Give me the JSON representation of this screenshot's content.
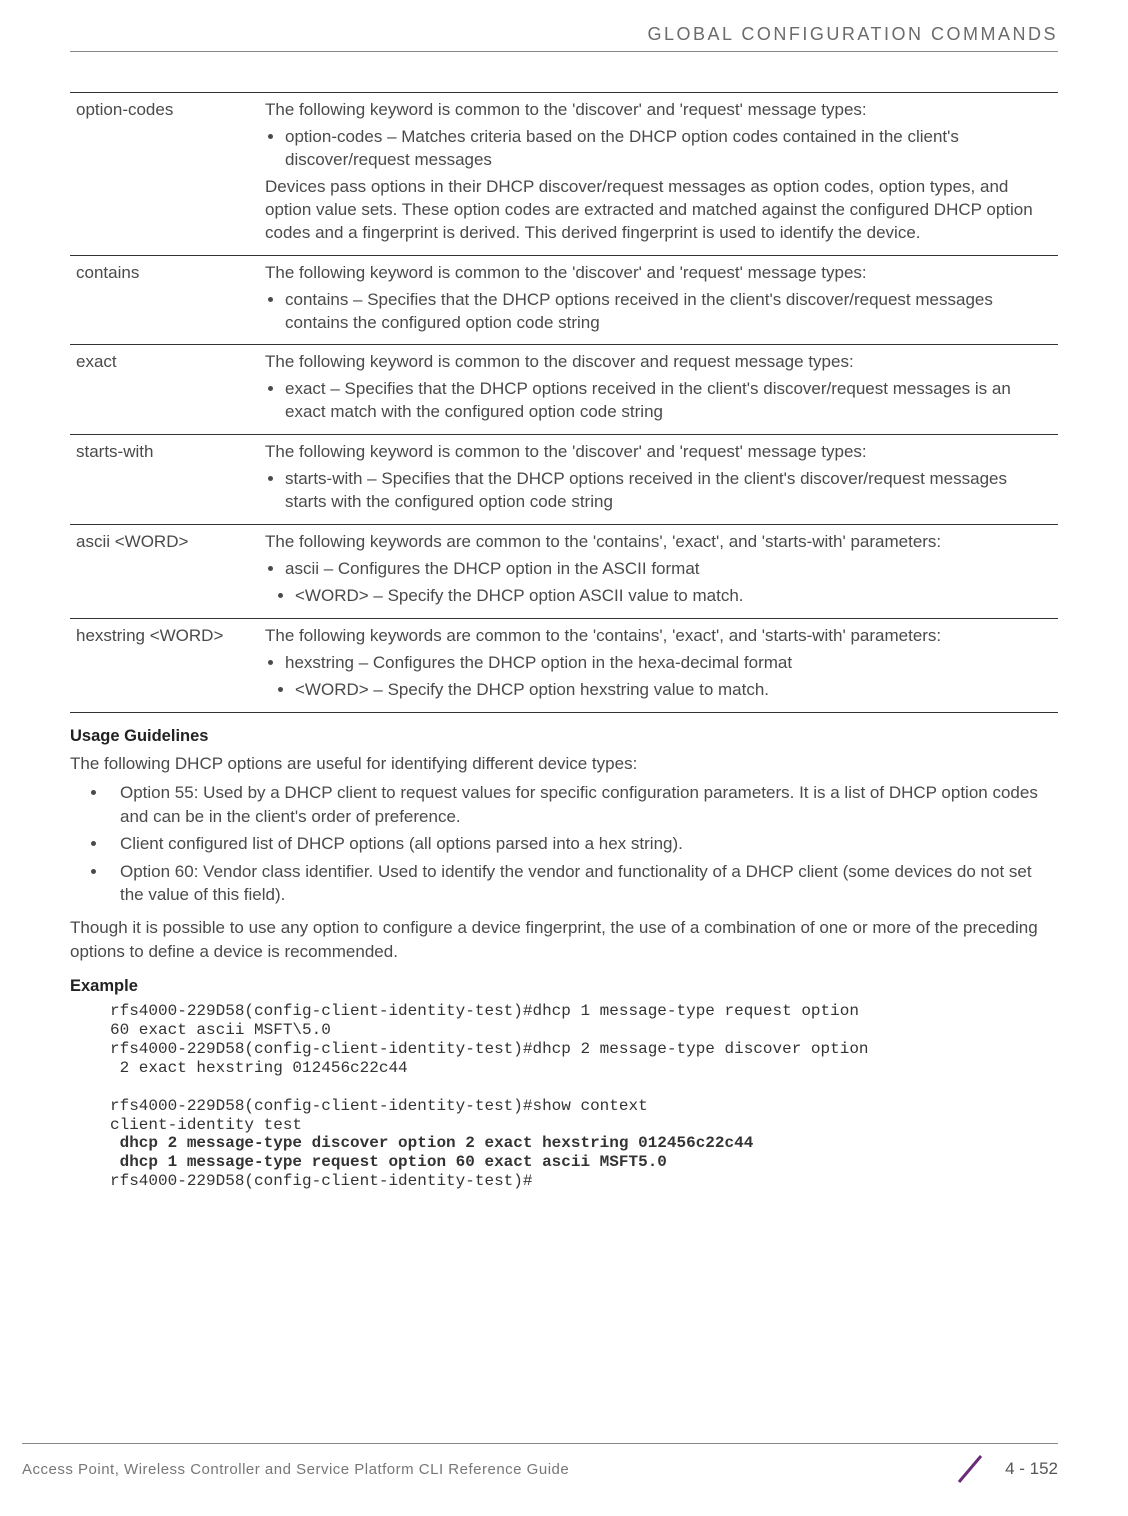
{
  "header": {
    "title": "GLOBAL CONFIGURATION COMMANDS"
  },
  "table": {
    "rows": [
      {
        "key": "option-codes",
        "intro": "The following keyword is common to the 'discover' and 'request' message types:",
        "bullets": [
          "option-codes – Matches criteria based on the DHCP option codes contained in the client's discover/request messages"
        ],
        "tail": "Devices pass options in their DHCP discover/request messages as option codes, option types, and option value sets. These option codes are extracted and matched against the configured DHCP option codes and a fingerprint is derived. This derived fingerprint is used to identify the device."
      },
      {
        "key": "contains",
        "intro": "The following keyword is common to the 'discover' and 'request' message types:",
        "bullets": [
          "contains – Specifies that the DHCP options received in the client's discover/request messages contains the configured option code string"
        ]
      },
      {
        "key": "exact",
        "intro": "The following keyword is common to the discover and request message types:",
        "bullets": [
          "exact – Specifies that the DHCP options received in the client's discover/request messages is an exact match with the configured option code string"
        ]
      },
      {
        "key": "starts-with",
        "intro": "The following keyword is common to the 'discover' and 'request' message types:",
        "bullets": [
          "starts-with – Specifies that the DHCP options received in the client's discover/request messages starts with the configured option code string"
        ]
      },
      {
        "key": "ascii <WORD>",
        "intro": "The following keywords are common to the 'contains', 'exact', and 'starts-with' parameters:",
        "bullets": [
          "ascii – Configures the DHCP option in the ASCII format"
        ],
        "subbullets": [
          "<WORD> – Specify the DHCP option ASCII value to match."
        ]
      },
      {
        "key": "hexstring <WORD>",
        "intro": "The following keywords are common to the 'contains', 'exact', and 'starts-with' parameters:",
        "bullets": [
          "hexstring – Configures the DHCP option in the hexa-decimal format"
        ],
        "subbullets": [
          "<WORD> – Specify the DHCP option hexstring value to match."
        ]
      }
    ]
  },
  "usage": {
    "heading": "Usage Guidelines",
    "intro": "The following DHCP options are useful for identifying different device types:",
    "items": [
      "Option 55: Used by a DHCP client to request values for specific configuration parameters. It is a list of DHCP option codes and can be in the client's order of preference.",
      "Client configured list of DHCP options (all options parsed into a hex string).",
      "Option 60: Vendor class identifier. Used to identify the vendor and functionality of a DHCP client (some devices do not set the value of this field)."
    ],
    "tail": "Though it is possible to use any option to configure a device fingerprint, the use of a combination of one or more of the preceding options to define a device is recommended."
  },
  "example": {
    "heading": "Example",
    "lines": [
      {
        "t": "rfs4000-229D58(config-client-identity-test)#dhcp 1 message-type request option",
        "b": false
      },
      {
        "t": "60 exact ascii MSFT\\5.0",
        "b": false
      },
      {
        "t": "rfs4000-229D58(config-client-identity-test)#dhcp 2 message-type discover option",
        "b": false
      },
      {
        "t": " 2 exact hexstring 012456c22c44",
        "b": false
      },
      {
        "t": "",
        "b": false
      },
      {
        "t": "rfs4000-229D58(config-client-identity-test)#show context",
        "b": false
      },
      {
        "t": "client-identity test",
        "b": false
      },
      {
        "t": " dhcp 2 message-type discover option 2 exact hexstring 012456c22c44",
        "b": true
      },
      {
        "t": " dhcp 1 message-type request option 60 exact ascii MSFT5.0",
        "b": true
      },
      {
        "t": "rfs4000-229D58(config-client-identity-test)#",
        "b": false
      }
    ]
  },
  "footer": {
    "left": "Access Point, Wireless Controller and Service Platform CLI Reference Guide",
    "right": "4 - 152"
  }
}
